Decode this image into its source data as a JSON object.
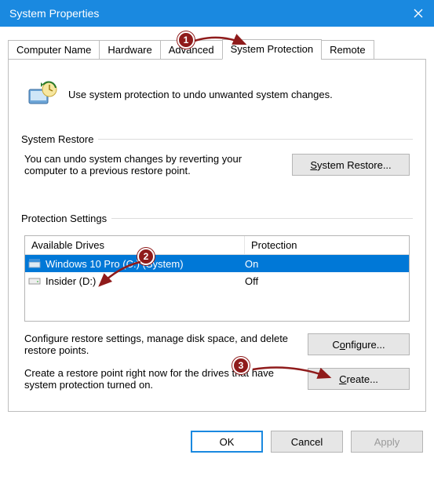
{
  "window": {
    "title": "System Properties"
  },
  "tabs": {
    "items": [
      {
        "label": "Computer Name"
      },
      {
        "label": "Hardware"
      },
      {
        "label": "Advanced"
      },
      {
        "label": "System Protection",
        "active": true
      },
      {
        "label": "Remote"
      }
    ]
  },
  "intro": {
    "text": "Use system protection to undo unwanted system changes."
  },
  "restore": {
    "group_label": "System Restore",
    "text": "You can undo system changes by reverting your computer to a previous restore point.",
    "button_label": "System Restore..."
  },
  "protection": {
    "group_label": "Protection Settings",
    "col_drives": "Available Drives",
    "col_protection": "Protection",
    "drives": [
      {
        "icon": "drive-system",
        "name": "Windows 10 Pro (C:) (System)",
        "status": "On",
        "selected": true
      },
      {
        "icon": "drive",
        "name": "Insider (D:)",
        "status": "Off",
        "selected": false
      }
    ],
    "configure_text": "Configure restore settings, manage disk space, and delete restore points.",
    "configure_label": "Configure...",
    "create_text": "Create a restore point right now for the drives that have system protection turned on.",
    "create_label": "Create..."
  },
  "buttons": {
    "ok": "OK",
    "cancel": "Cancel",
    "apply": "Apply"
  },
  "annotations": {
    "one": "1",
    "two": "2",
    "three": "3"
  }
}
